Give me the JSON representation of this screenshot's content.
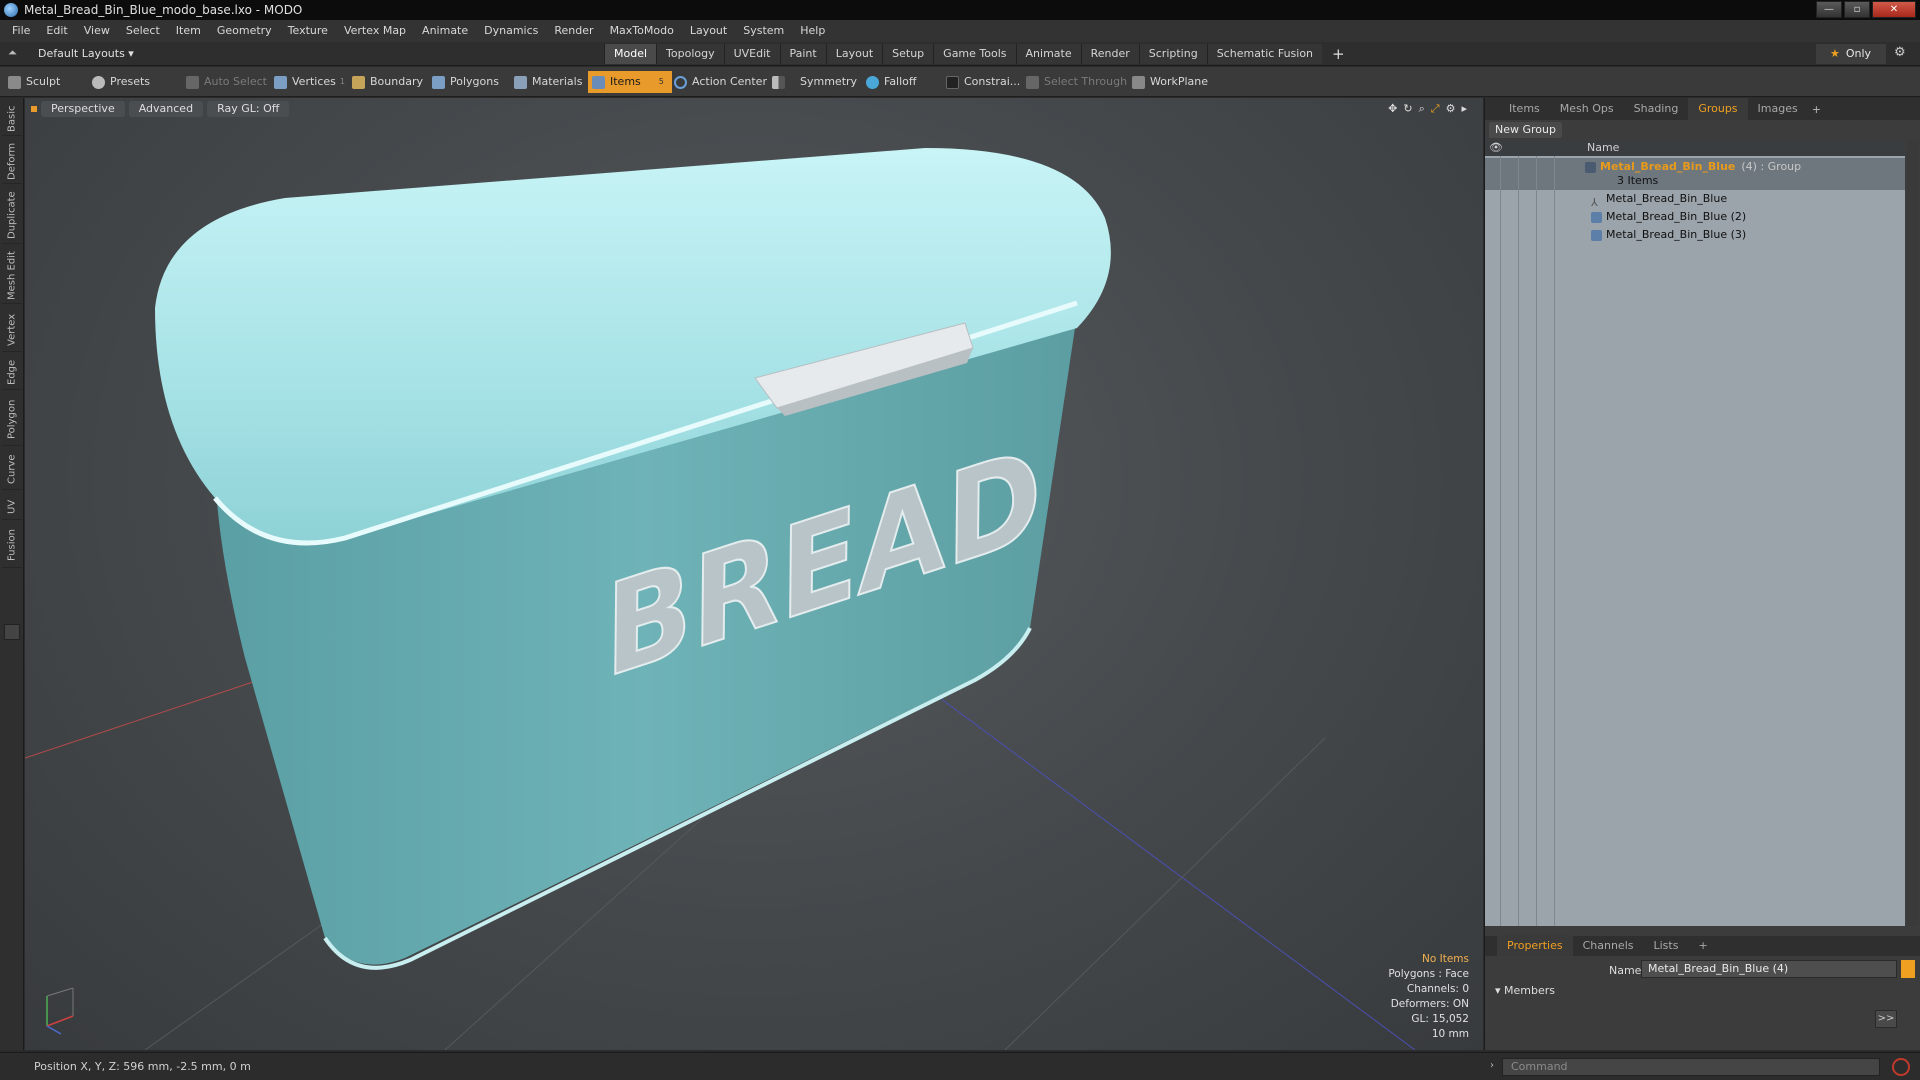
{
  "window": {
    "title": "Metal_Bread_Bin_Blue_modo_base.lxo - MODO",
    "minimize": "—",
    "maximize": "▫",
    "close": "✕"
  },
  "menu": [
    "File",
    "Edit",
    "View",
    "Select",
    "Item",
    "Geometry",
    "Texture",
    "Vertex Map",
    "Animate",
    "Dynamics",
    "Render",
    "MaxToModo",
    "Layout",
    "System",
    "Help"
  ],
  "layout": {
    "dropdown": "Default Layouts ▾",
    "tabs": [
      "Model",
      "Topology",
      "UVEdit",
      "Paint",
      "Layout",
      "Setup",
      "Game Tools",
      "Animate",
      "Render",
      "Scripting",
      "Schematic Fusion"
    ],
    "active_tab": "Model",
    "only_label": "Only"
  },
  "toolbar": {
    "sculpt": "Sculpt",
    "presets": "Presets",
    "auto_select": "Auto Select",
    "vertices": "Vertices",
    "vertices_count": "1",
    "boundary": "Boundary",
    "polygons": "Polygons",
    "materials": "Materials",
    "items": "Items",
    "items_count": "5",
    "action_center": "Action Center",
    "symmetry": "Symmetry",
    "falloff": "Falloff",
    "constraints": "Constrai...",
    "select_through": "Select Through",
    "workplane": "WorkPlane"
  },
  "left_tabs": [
    "Basic",
    "Deform",
    "Duplicate",
    "Mesh Edit",
    "Vertex",
    "Edge",
    "Polygon",
    "Curve",
    "UV",
    "Fusion"
  ],
  "viewport": {
    "tabs": [
      "Perspective",
      "Advanced",
      "Ray GL: Off"
    ],
    "model_text": "BREAD",
    "stats": {
      "no_items": "No Items",
      "polygons": "Polygons : Face",
      "channels": "Channels: 0",
      "deformers": "Deformers: ON",
      "gl": "GL: 15,052",
      "scale": "10 mm"
    }
  },
  "right_panel": {
    "tabs": [
      "Items",
      "Mesh Ops",
      "Shading",
      "Groups",
      "Images"
    ],
    "active_tab": "Groups",
    "new_group": "New Group",
    "col_name": "Name",
    "group": {
      "name": "Metal_Bread_Bin_Blue",
      "suffix": "(4) : Group",
      "count": "3 Items"
    },
    "children": [
      "Metal_Bread_Bin_Blue",
      "Metal_Bread_Bin_Blue (2)",
      "Metal_Bread_Bin_Blue (3)"
    ]
  },
  "properties": {
    "tabs": [
      "Properties",
      "Channels",
      "Lists"
    ],
    "active_tab": "Properties",
    "name_label": "Name",
    "name_value": "Metal_Bread_Bin_Blue (4)",
    "members": "Members",
    "members_btn": ">>"
  },
  "status": {
    "position": "Position X, Y, Z:  596 mm, -2.5 mm, 0 m"
  },
  "command": {
    "placeholder": "Command"
  },
  "colors": {
    "accent": "#e89a2a",
    "bin_body": "#6fb4b8",
    "bin_lid": "#a8e6ea"
  }
}
